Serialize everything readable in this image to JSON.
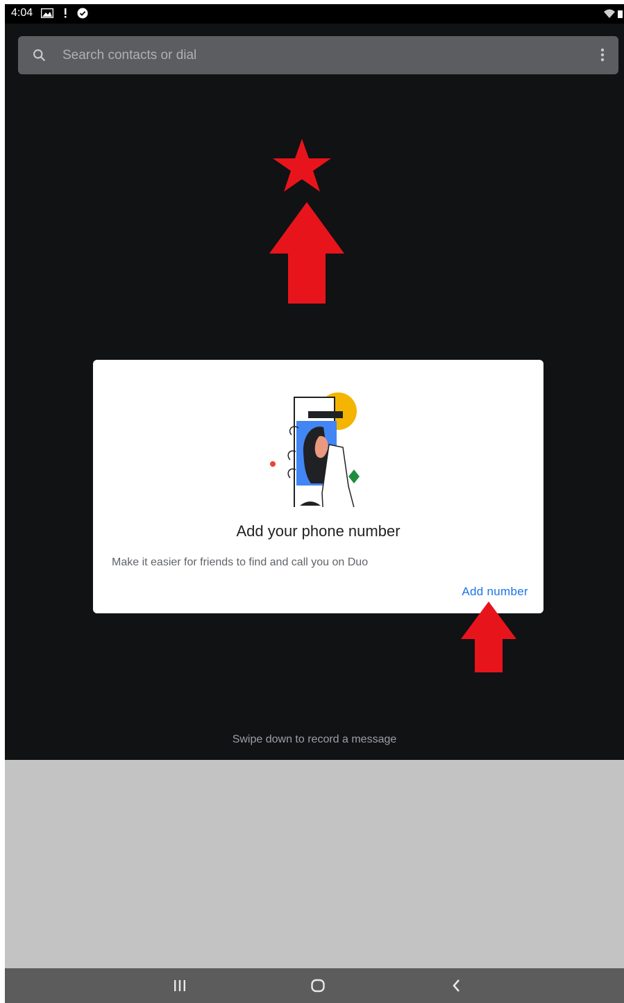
{
  "status_bar": {
    "time": "4:04",
    "left_icons": [
      "gallery-icon",
      "alert-icon",
      "check-circle-icon"
    ],
    "right_icons": [
      "wifi-icon",
      "battery-icon"
    ]
  },
  "search": {
    "placeholder": "Search contacts or dial",
    "value": ""
  },
  "card": {
    "title": "Add your phone number",
    "description": "Make it easier for friends to find and call you on Duo",
    "action_label": "Add number"
  },
  "swipe_hint": "Swipe down to record a message",
  "nav_bar": {
    "buttons": [
      "recents-icon",
      "home-icon",
      "back-icon"
    ]
  },
  "annotations": {
    "color": "#e8141c",
    "marks": [
      "star-marker",
      "arrow-up-marker",
      "arrow-up-marker"
    ]
  },
  "colors": {
    "background": "#111214",
    "card": "#ffffff",
    "accent": "#1a73e8",
    "search_bar": "#5b5d60",
    "bottom_sheet": "#c3c3c3",
    "nav_bar": "#5c5c5c"
  }
}
